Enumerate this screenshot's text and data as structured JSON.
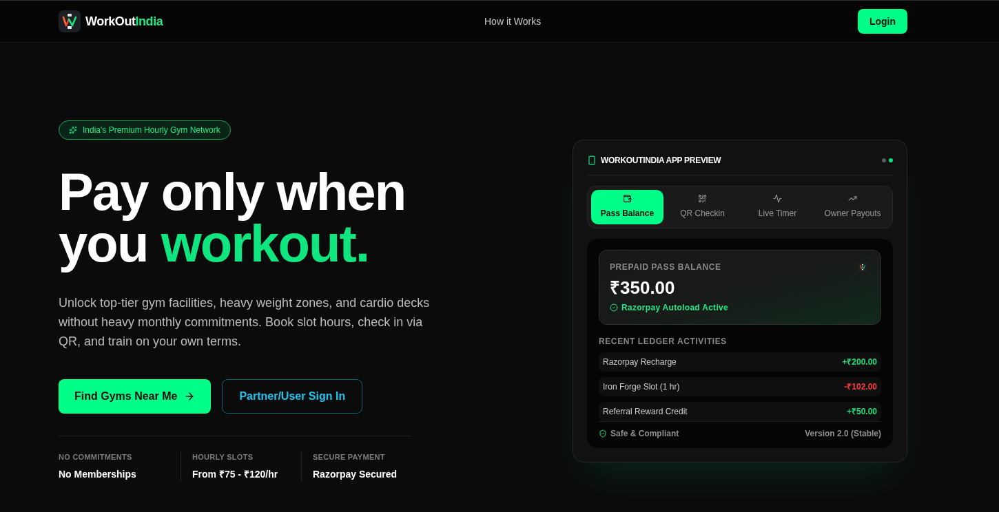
{
  "nav": {
    "brand": {
      "part_1": "WorkOut",
      "part_2": "India"
    },
    "links": [
      "How it Works"
    ],
    "login_button": "Login"
  },
  "hero": {
    "badge": "India's Premium Hourly Gym Network",
    "headline": {
      "line_1": "Pay only when",
      "line_2_start": "you",
      "line_2_highlight": "workout."
    },
    "description": "Unlock top-tier gym facilities, heavy weight zones, and cardio decks without heavy monthly commitments. Book slot hours, check in via QR, and train on your own terms.",
    "primary_button": "Find Gyms Near Me",
    "secondary_button": "Partner/User Sign In",
    "stats": [
      {
        "label": "NO COMMITMENTS",
        "value": "No Memberships"
      },
      {
        "label": "HOURLY SLOTS",
        "value": "From ₹75 - ₹120/hr"
      },
      {
        "label": "SECURE PAYMENT",
        "value": "Razorpay Secured"
      }
    ]
  },
  "preview": {
    "title": "WORKOUTINDIA APP PREVIEW",
    "status_dots": [
      {
        "color": "#5a5a5a"
      },
      {
        "color": "#00e67a"
      }
    ],
    "tabs": [
      {
        "label": "Pass Balance",
        "selected": true
      },
      {
        "label": "QR Checkin",
        "selected": false
      },
      {
        "label": "Live Timer",
        "selected": false
      },
      {
        "label": "Owner Payouts",
        "selected": false
      }
    ],
    "balance": {
      "label": "PREPAID PASS BALANCE",
      "amount": "₹350.00",
      "status": "Razorpay Autoload Active"
    },
    "ledger": {
      "title": "RECENT LEDGER ACTIVITIES",
      "rows": [
        {
          "description": "Razorpay Recharge",
          "amount": "+₹200.00",
          "kind": "credit"
        },
        {
          "description": "Iron Forge Slot (1 hr)",
          "amount": "-₹102.00",
          "kind": "debit"
        },
        {
          "description": "Referral Reward Credit",
          "amount": "+₹50.00",
          "kind": "credit"
        }
      ]
    },
    "footer": {
      "compliance": "Safe & Compliant",
      "version": "Version 2.0 (Stable)"
    }
  }
}
